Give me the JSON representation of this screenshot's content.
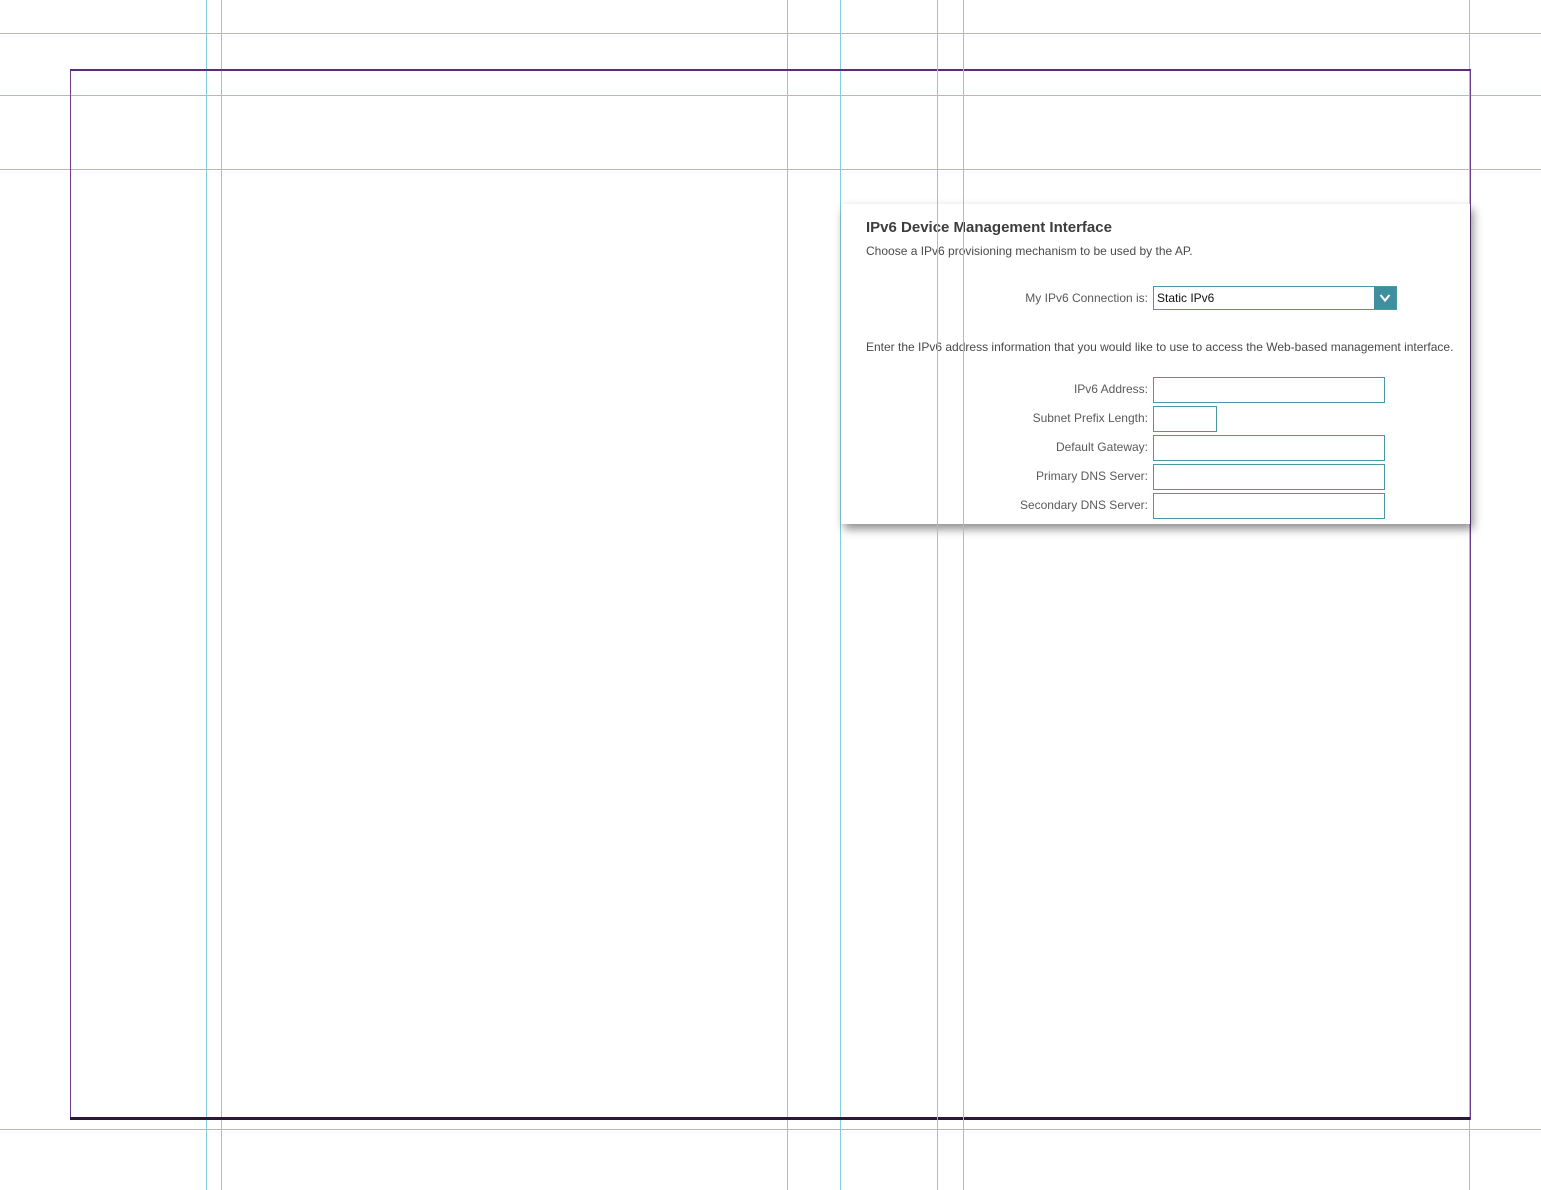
{
  "panel": {
    "title": "IPv6 Device Management Interface",
    "description": "Choose a IPv6 provisioning mechanism to be used by the AP.",
    "connection": {
      "label": "My IPv6 Connection is:",
      "selected": "Static IPv6",
      "icon": "chevron-down-icon"
    },
    "instructions": "Enter the IPv6 address information that you would like to use to access the Web-based management interface.",
    "fields": [
      {
        "label": "IPv6 Address:",
        "value": ""
      },
      {
        "label": "Subnet Prefix Length:",
        "value": ""
      },
      {
        "label": "Default Gateway:",
        "value": ""
      },
      {
        "label": "Primary DNS Server:",
        "value": ""
      },
      {
        "label": "Secondary DNS Server:",
        "value": ""
      }
    ]
  },
  "colors": {
    "accent": "#3f8f9f",
    "guide": "#7fcfe0",
    "frame": "#6a3d8f"
  }
}
